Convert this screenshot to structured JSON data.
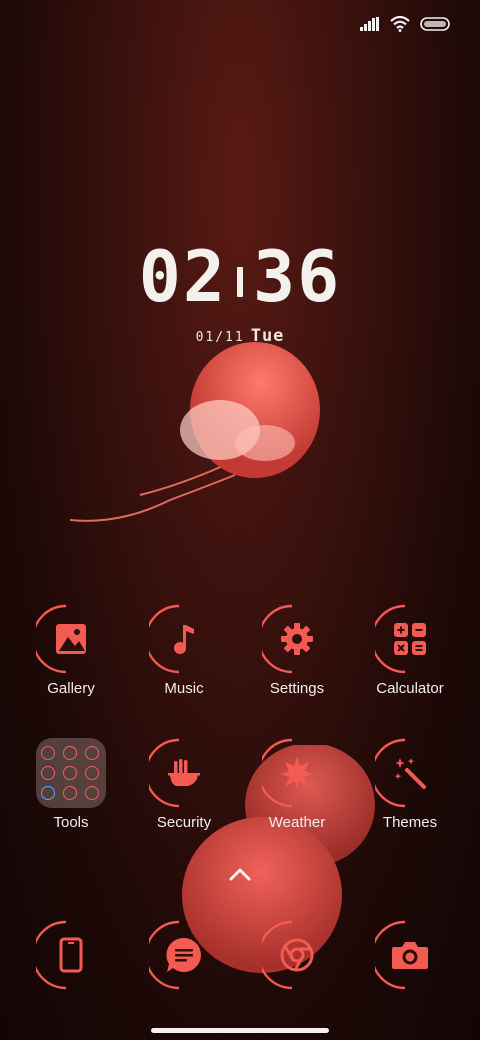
{
  "clock": {
    "hours": "02",
    "minutes": "36"
  },
  "date": {
    "day": "01/11",
    "weekday": "Tue"
  },
  "accent": "#f25a52",
  "apps_row1": [
    {
      "label": "Gallery",
      "icon": "gallery-icon"
    },
    {
      "label": "Music",
      "icon": "music-note-icon"
    },
    {
      "label": "Settings",
      "icon": "gear-icon"
    },
    {
      "label": "Calculator",
      "icon": "calculator-icon"
    }
  ],
  "apps_row2": [
    {
      "label": "Tools",
      "icon": "folder-icon"
    },
    {
      "label": "Security",
      "icon": "shield-hand-icon"
    },
    {
      "label": "Weather",
      "icon": "weather-leaf-icon"
    },
    {
      "label": "Themes",
      "icon": "magic-wand-icon"
    }
  ],
  "dock": [
    {
      "icon": "phone-icon"
    },
    {
      "icon": "messages-icon"
    },
    {
      "icon": "chrome-icon"
    },
    {
      "icon": "camera-icon"
    }
  ]
}
